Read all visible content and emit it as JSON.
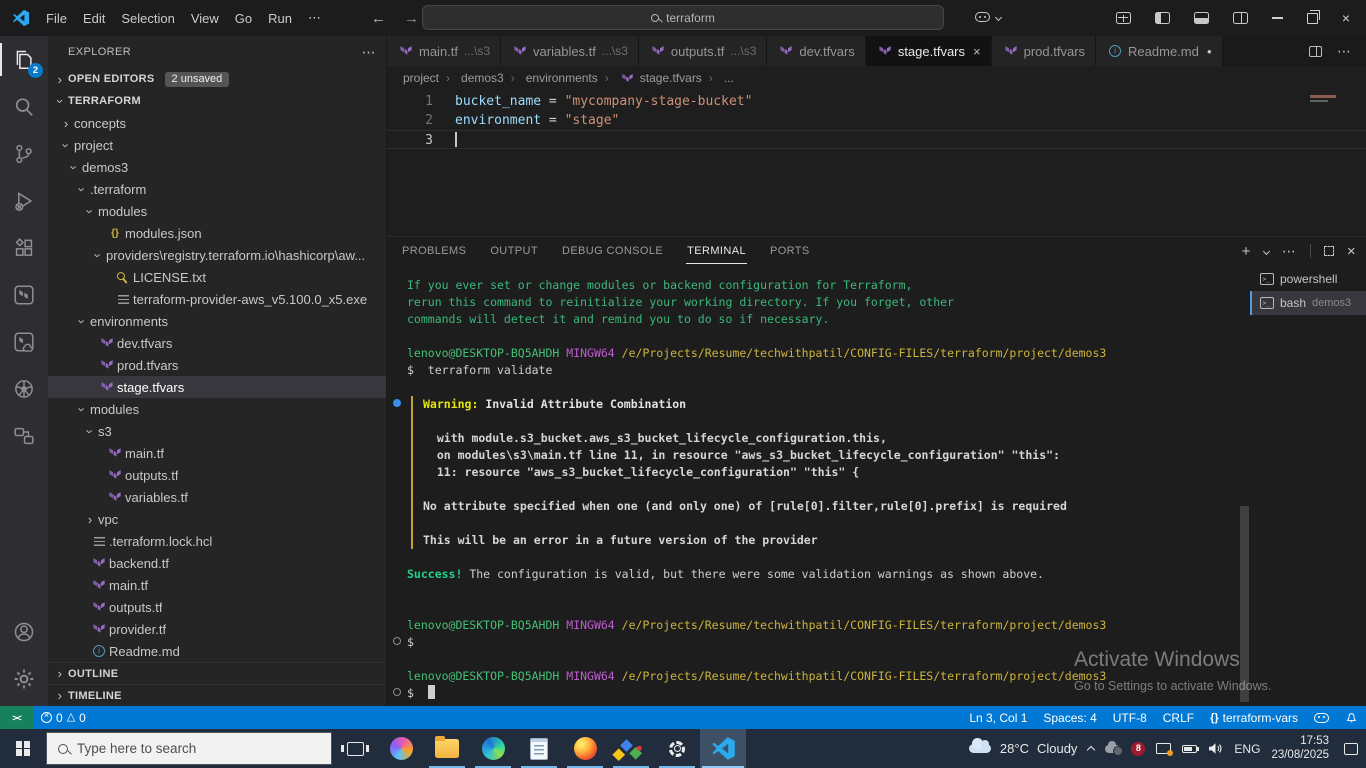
{
  "titlebar": {
    "menus": [
      {
        "label": "File"
      },
      {
        "label": "Edit"
      },
      {
        "label": "Selection"
      },
      {
        "label": "View"
      },
      {
        "label": "Go"
      },
      {
        "label": "Run"
      },
      {
        "label": "⋯"
      }
    ],
    "search_value": "terraform"
  },
  "activity_bar": {
    "top": [
      {
        "icon": "files",
        "state": "active",
        "badge": "2"
      },
      {
        "icon": "search"
      },
      {
        "icon": "scm"
      },
      {
        "icon": "debug"
      },
      {
        "icon": "extensions"
      },
      {
        "icon": "terraform"
      },
      {
        "icon": "tfcloud"
      },
      {
        "icon": "kubernetes"
      },
      {
        "icon": "containers"
      }
    ],
    "bottom": [
      {
        "icon": "account"
      },
      {
        "icon": "settings"
      }
    ]
  },
  "explorer": {
    "title": "EXPLORER",
    "more": "⋯",
    "open_editors_label": "OPEN EDITORS",
    "unsaved_badge": "2 unsaved",
    "root_label": "TERRAFORM",
    "outline_label": "OUTLINE",
    "timeline_label": "TIMELINE",
    "tree": [
      {
        "depth": 1,
        "twisty": "right",
        "icon": "none",
        "label": "concepts"
      },
      {
        "depth": 1,
        "twisty": "down",
        "icon": "none",
        "label": "project"
      },
      {
        "depth": 2,
        "twisty": "down",
        "icon": "none",
        "label": "demos3"
      },
      {
        "depth": 3,
        "twisty": "down",
        "icon": "none",
        "label": ".terraform"
      },
      {
        "depth": 4,
        "twisty": "down",
        "icon": "none",
        "label": "modules"
      },
      {
        "depth": 5,
        "twisty": "none",
        "icon": "json",
        "label": "modules.json"
      },
      {
        "depth": 5,
        "twisty": "down",
        "icon": "none",
        "label": "providers\\registry.terraform.io\\hashicorp\\aw..."
      },
      {
        "depth": 6,
        "twisty": "none",
        "icon": "key",
        "label": "LICENSE.txt"
      },
      {
        "depth": 6,
        "twisty": "none",
        "icon": "lines",
        "label": "terraform-provider-aws_v5.100.0_x5.exe"
      },
      {
        "depth": 3,
        "twisty": "down",
        "icon": "none",
        "label": "environments"
      },
      {
        "depth": 4,
        "twisty": "none",
        "icon": "terraform",
        "label": "dev.tfvars"
      },
      {
        "depth": 4,
        "twisty": "none",
        "icon": "terraform",
        "label": "prod.tfvars"
      },
      {
        "depth": 4,
        "twisty": "none",
        "icon": "terraform",
        "label": "stage.tfvars",
        "state": "selected"
      },
      {
        "depth": 3,
        "twisty": "down",
        "icon": "none",
        "label": "modules"
      },
      {
        "depth": 4,
        "twisty": "down",
        "icon": "none",
        "label": "s3"
      },
      {
        "depth": 5,
        "twisty": "none",
        "icon": "terraform",
        "label": "main.tf"
      },
      {
        "depth": 5,
        "twisty": "none",
        "icon": "terraform",
        "label": "outputs.tf"
      },
      {
        "depth": 5,
        "twisty": "none",
        "icon": "terraform",
        "label": "variables.tf"
      },
      {
        "depth": 4,
        "twisty": "right",
        "icon": "none",
        "label": "vpc"
      },
      {
        "depth": 3,
        "twisty": "none",
        "icon": "lines",
        "label": ".terraform.lock.hcl"
      },
      {
        "depth": 3,
        "twisty": "none",
        "icon": "terraform",
        "label": "backend.tf"
      },
      {
        "depth": 3,
        "twisty": "none",
        "icon": "terraform",
        "label": "main.tf"
      },
      {
        "depth": 3,
        "twisty": "none",
        "icon": "terraform",
        "label": "outputs.tf"
      },
      {
        "depth": 3,
        "twisty": "none",
        "icon": "terraform",
        "label": "provider.tf"
      },
      {
        "depth": 3,
        "twisty": "none",
        "icon": "info",
        "label": "Readme.md"
      }
    ]
  },
  "tabs": {
    "items": [
      {
        "name": "main.tf",
        "desc": "...\\s3",
        "icon": "terraform"
      },
      {
        "name": "variables.tf",
        "desc": "...\\s3",
        "icon": "terraform"
      },
      {
        "name": "outputs.tf",
        "desc": "...\\s3",
        "icon": "terraform"
      },
      {
        "name": "dev.tfvars",
        "icon": "terraform"
      },
      {
        "name": "stage.tfvars",
        "icon": "terraform",
        "state": "active",
        "close": true
      },
      {
        "name": "prod.tfvars",
        "icon": "terraform"
      },
      {
        "name": "Readme.md",
        "icon": "info",
        "modified": true
      }
    ]
  },
  "breadcrumb": {
    "items": [
      {
        "label": "project"
      },
      {
        "label": "demos3"
      },
      {
        "label": "environments"
      },
      {
        "label": "stage.tfvars",
        "icon": "terraform"
      },
      {
        "label": "..."
      }
    ]
  },
  "editor": {
    "lines": [
      {
        "num": "1",
        "tokens": [
          {
            "text": "bucket_name",
            "type": "ident"
          },
          {
            "text": " = ",
            "type": "op"
          },
          {
            "text": "\"mycompany-stage-bucket\"",
            "type": "str"
          }
        ]
      },
      {
        "num": "2",
        "tokens": [
          {
            "text": "environment",
            "type": "ident"
          },
          {
            "text": " = ",
            "type": "op"
          },
          {
            "text": "\"stage\"",
            "type": "str"
          }
        ]
      },
      {
        "num": "3",
        "tokens": [],
        "current": true
      }
    ]
  },
  "panel": {
    "tabs": [
      {
        "label": "PROBLEMS"
      },
      {
        "label": "OUTPUT"
      },
      {
        "label": "DEBUG CONSOLE"
      },
      {
        "label": "TERMINAL",
        "state": "active"
      },
      {
        "label": "PORTS"
      }
    ],
    "terminals": [
      {
        "label": "powershell",
        "icon": "shell"
      },
      {
        "label": "bash",
        "detail": "demos3",
        "icon": "shell",
        "state": "active"
      }
    ]
  },
  "terminal": {
    "prompt_user": "lenovo@DESKTOP-BQ5AHDH",
    "prompt_env": "MINGW64",
    "prompt_path": "/e/Projects/Resume/techwithpatil/CONFIG-FILES/terraform/project/demos3",
    "prompt_char": "$",
    "blocks": [
      {
        "kind": "text",
        "color": "green",
        "lines": [
          "If you ever set or change modules or backend configuration for Terraform,",
          "rerun this command to reinitialize your working directory. If you forget, other",
          "commands will detect it and remind you to do so if necessary."
        ]
      },
      {
        "kind": "blank"
      },
      {
        "kind": "prompt"
      },
      {
        "kind": "command",
        "text": "terraform validate"
      },
      {
        "kind": "blank"
      },
      {
        "kind": "warning",
        "title_label": "Warning:",
        "title": "Invalid Attribute Combination",
        "lines": [
          "",
          "  with module.s3_bucket.aws_s3_bucket_lifecycle_configuration.this,",
          "  on modules\\s3\\main.tf line 11, in resource \"aws_s3_bucket_lifecycle_configuration\" \"this\":",
          "  11: resource \"aws_s3_bucket_lifecycle_configuration\" \"this\" {",
          "",
          "No attribute specified when one (and only one) of [rule[0].filter,rule[0].prefix] is required",
          "",
          "This will be an error in a future version of the provider"
        ]
      },
      {
        "kind": "blank"
      },
      {
        "kind": "success",
        "label": "Success!",
        "text": "The configuration is valid, but there were some validation warnings as shown above."
      },
      {
        "kind": "blank"
      },
      {
        "kind": "blank"
      },
      {
        "kind": "prompt"
      },
      {
        "kind": "command",
        "text": ""
      },
      {
        "kind": "blank"
      },
      {
        "kind": "prompt"
      },
      {
        "kind": "command",
        "text": "",
        "cursor": true
      }
    ]
  },
  "status_bar": {
    "errors": "0",
    "warnings": "0",
    "right_items": [
      {
        "label": "Ln 3, Col 1"
      },
      {
        "label": "Spaces: 4"
      },
      {
        "label": "UTF-8"
      },
      {
        "label": "CRLF"
      },
      {
        "label": "terraform-vars",
        "icon": "braces"
      }
    ]
  },
  "taskbar": {
    "search_placeholder": "Type here to search",
    "apps": [
      {
        "icon": "taskview",
        "css": true
      },
      {
        "icon": "copilot",
        "css": true
      },
      {
        "icon": "explorer",
        "css": true,
        "running": true
      },
      {
        "icon": "edge",
        "css": true,
        "running": true
      },
      {
        "icon": "notepad",
        "css": true,
        "running": true
      },
      {
        "icon": "firefox",
        "css": true,
        "running": true
      },
      {
        "icon": "diagram",
        "css": true,
        "running": true
      },
      {
        "icon": "gear",
        "css": true,
        "running": true
      },
      {
        "icon": "vscode",
        "running": true,
        "state": "active"
      }
    ],
    "tray": {
      "weather_temp": "28°C",
      "weather_cond": "Cloudy",
      "lang": "ENG",
      "time": "17:53",
      "date": "23/08/2025"
    }
  },
  "watermark": {
    "line1": "Activate Windows",
    "line2": "Go to Settings to activate Windows."
  }
}
